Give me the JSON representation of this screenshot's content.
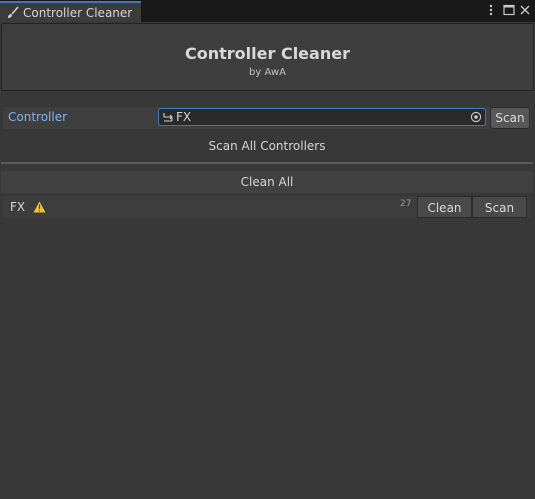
{
  "window": {
    "tab_title": "Controller Cleaner",
    "tab_icon": "brush-icon",
    "controls": [
      "kebab-menu-icon",
      "maximize-icon",
      "close-icon"
    ]
  },
  "header": {
    "title": "Controller Cleaner",
    "subtitle": "by AwA"
  },
  "controller_field": {
    "label": "Controller",
    "value": "FX",
    "value_icon": "animator-controller-icon",
    "picker_icon": "object-picker-icon",
    "scan_label": "Scan"
  },
  "actions": {
    "scan_all_label": "Scan All Controllers",
    "clean_all_label": "Clean All"
  },
  "results": [
    {
      "name": "FX",
      "status_icon": "warning-icon",
      "count": "27",
      "clean_label": "Clean",
      "scan_label": "Scan"
    }
  ],
  "colors": {
    "accent": "#3a79bb",
    "label_blue": "#7fb3f0",
    "warning": "#f2c12e",
    "background": "#383838"
  }
}
